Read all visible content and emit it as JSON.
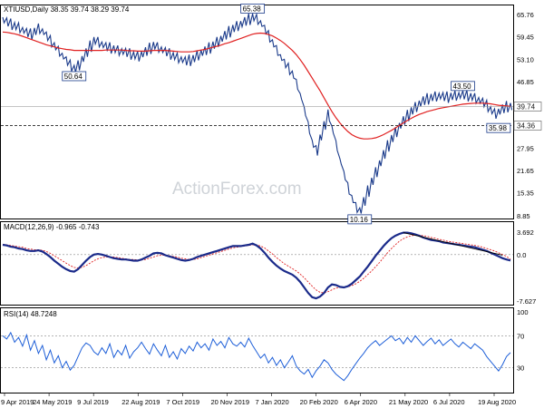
{
  "header": {
    "symbol_line": "XTIUSD,Daily  38.35 39.74 38.29 39.74",
    "macd_line": "MACD(12,26,9) -0.965 -0.743",
    "rsi_line": "RSI(14) 48.7248"
  },
  "watermark": "ActionForex.com",
  "colors": {
    "price": "#1a3a8a",
    "ma": "#e02020",
    "macd": "#1a2a8a",
    "signal": "#e02020",
    "rsi": "#1e5fd8",
    "trend": "#000000",
    "grid": "#b8b8b8"
  },
  "chart_data": [
    {
      "type": "line",
      "panel": "price",
      "x_dates": [
        "9 Apr 2019",
        "24 May 2019",
        "9 Jul 2019",
        "22 Aug 2019",
        "7 Oct 2019",
        "20 Nov 2019",
        "7 Jan 2020",
        "20 Feb 2020",
        "6 Apr 2020",
        "21 May 2020",
        "6 Jul 2020",
        "19 Aug 2020"
      ],
      "y_ticks": [
        "65.76",
        "59.45",
        "53.10",
        "46.85",
        "40.55",
        "34.26",
        "27.95",
        "21.65",
        "15.35",
        "8.85"
      ],
      "ylim": [
        8.85,
        65.76
      ],
      "price_box": "39.74",
      "dashed_level": "34.36",
      "series": [
        {
          "values": [
            64.2,
            63.6,
            63.0,
            62.5,
            62.0,
            61.3,
            60.6,
            60.2,
            61.0,
            61.8,
            60.9,
            59.6,
            58.2,
            56.8,
            55.4,
            54.0,
            52.6,
            51.3,
            50.4,
            51.4,
            53.2,
            55.0,
            56.8,
            58.4,
            58.0,
            57.2,
            56.6,
            56.3,
            56.0,
            55.6,
            55.3,
            55.0,
            54.6,
            54.2,
            53.9,
            54.5,
            55.3,
            56.2,
            57.0,
            56.5,
            55.8,
            55.2,
            54.6,
            54.0,
            53.5,
            53.0,
            52.6,
            52.8,
            53.3,
            54.2,
            54.9,
            55.5,
            56.3,
            57.1,
            58.0,
            58.9,
            59.9,
            60.9,
            61.8,
            62.5,
            63.1,
            63.8,
            64.4,
            65.0,
            64.4,
            63.2,
            61.5,
            59.6,
            57.6,
            55.6,
            53.6,
            51.9,
            50.4,
            48.8,
            46.0,
            42.6,
            38.4,
            33.8,
            29.2,
            27.3,
            31.0,
            34.4,
            37.3,
            33.2,
            28.7,
            24.2,
            20.2,
            16.6,
            13.6,
            11.2,
            10.3,
            12.9,
            15.8,
            18.6,
            21.2,
            23.7,
            26.2,
            28.6,
            30.7,
            32.5,
            34.3,
            35.8,
            37.2,
            38.5,
            39.6,
            40.6,
            41.4,
            41.9,
            42.3,
            42.6,
            42.7,
            42.5,
            42.4,
            42.6,
            42.8,
            42.9,
            43.0,
            42.8,
            42.5,
            42.1,
            41.5,
            40.9,
            39.9,
            38.7,
            37.7,
            38.3,
            39.1,
            39.7,
            39.74
          ]
        },
        {
          "name_hidden": true,
          "values": [
            60.8,
            60.7,
            60.5,
            60.3,
            60.0,
            59.6,
            59.2,
            58.8,
            58.4,
            58.0,
            57.6,
            57.2,
            56.9,
            56.6,
            56.3,
            56.1,
            55.9,
            55.8,
            55.6,
            55.6,
            55.6,
            55.6,
            55.6,
            55.6,
            55.6,
            55.6,
            55.7,
            55.7,
            55.7,
            55.7,
            55.7,
            55.6,
            55.5,
            55.5,
            55.4,
            55.4,
            55.4,
            55.5,
            55.6,
            55.6,
            55.6,
            55.6,
            55.5,
            55.4,
            55.3,
            55.2,
            55.2,
            55.2,
            55.3,
            55.5,
            55.7,
            55.9,
            56.2,
            56.5,
            56.8,
            57.1,
            57.5,
            57.8,
            58.2,
            58.6,
            59.0,
            59.4,
            59.8,
            60.2,
            60.4,
            60.5,
            60.4,
            60.1,
            59.7,
            59.1,
            58.4,
            57.6,
            56.6,
            55.6,
            54.4,
            53.0,
            51.4,
            49.6,
            47.8,
            46.0,
            44.2,
            42.2,
            40.2,
            38.3,
            36.6,
            35.1,
            33.8,
            32.7,
            31.8,
            31.2,
            30.8,
            30.6,
            30.6,
            30.7,
            30.9,
            31.3,
            31.8,
            32.4,
            33.0,
            33.7,
            34.4,
            35.1,
            35.8,
            36.4,
            37.0,
            37.5,
            37.9,
            38.3,
            38.6,
            38.9,
            39.2,
            39.4,
            39.6,
            39.8,
            40.0,
            40.2,
            40.4,
            40.5,
            40.6,
            40.7,
            40.7,
            40.7,
            40.6,
            40.5,
            40.3,
            40.1,
            40.0,
            39.9,
            39.8
          ]
        }
      ],
      "annotations": [
        {
          "text": "65.38",
          "value": 65.38,
          "index": 63
        },
        {
          "text": "50.64",
          "value": 50.64,
          "index": 18
        },
        {
          "text": "10.16",
          "value": 10.16,
          "index": 90
        },
        {
          "text": "43.50",
          "value": 43.5,
          "index": 116
        },
        {
          "text": "35.98",
          "value": 35.98,
          "index": 125
        }
      ]
    },
    {
      "type": "line",
      "panel": "macd",
      "y_ticks": [
        "3.692",
        "0.0",
        "-7.627"
      ],
      "ylim": [
        -7.627,
        3.692
      ],
      "series": [
        {
          "values": [
            1.6,
            1.5,
            1.3,
            1.2,
            1.0,
            0.9,
            0.7,
            0.6,
            0.6,
            0.7,
            0.5,
            0.1,
            -0.4,
            -1.0,
            -1.5,
            -2.0,
            -2.4,
            -2.7,
            -2.8,
            -2.4,
            -1.7,
            -1.0,
            -0.4,
            0.0,
            0.1,
            0.0,
            -0.2,
            -0.4,
            -0.6,
            -0.7,
            -0.8,
            -0.8,
            -0.9,
            -1.0,
            -1.0,
            -0.8,
            -0.5,
            -0.2,
            0.2,
            0.3,
            0.2,
            -0.1,
            -0.3,
            -0.5,
            -0.7,
            -0.9,
            -1.0,
            -0.9,
            -0.7,
            -0.4,
            -0.2,
            0.0,
            0.2,
            0.4,
            0.6,
            0.8,
            1.0,
            1.2,
            1.4,
            1.4,
            1.4,
            1.5,
            1.6,
            1.8,
            1.5,
            1.0,
            0.3,
            -0.5,
            -1.2,
            -1.8,
            -2.3,
            -2.7,
            -3.0,
            -3.3,
            -3.8,
            -4.5,
            -5.4,
            -6.3,
            -7.0,
            -7.2,
            -6.9,
            -6.3,
            -5.4,
            -4.9,
            -5.0,
            -5.3,
            -5.4,
            -5.2,
            -4.8,
            -4.2,
            -3.6,
            -2.8,
            -2.0,
            -1.1,
            -0.2,
            0.6,
            1.4,
            2.1,
            2.7,
            3.1,
            3.4,
            3.6,
            3.6,
            3.5,
            3.3,
            3.1,
            2.8,
            2.6,
            2.4,
            2.3,
            2.2,
            2.0,
            1.9,
            1.8,
            1.7,
            1.6,
            1.5,
            1.4,
            1.3,
            1.2,
            1.0,
            0.8,
            0.6,
            0.3,
            0.0,
            -0.3,
            -0.6,
            -0.8,
            -0.97
          ]
        },
        {
          "values": [
            1.7,
            1.6,
            1.5,
            1.4,
            1.3,
            1.2,
            1.0,
            0.9,
            0.8,
            0.8,
            0.7,
            0.5,
            0.2,
            -0.2,
            -0.6,
            -1.0,
            -1.4,
            -1.8,
            -2.1,
            -2.2,
            -2.1,
            -1.8,
            -1.4,
            -1.0,
            -0.7,
            -0.5,
            -0.4,
            -0.4,
            -0.4,
            -0.5,
            -0.6,
            -0.7,
            -0.8,
            -0.8,
            -0.9,
            -0.9,
            -0.8,
            -0.6,
            -0.4,
            -0.2,
            -0.1,
            -0.1,
            -0.2,
            -0.3,
            -0.4,
            -0.6,
            -0.7,
            -0.8,
            -0.8,
            -0.7,
            -0.5,
            -0.3,
            -0.1,
            0.1,
            0.3,
            0.5,
            0.7,
            0.9,
            1.1,
            1.2,
            1.3,
            1.4,
            1.5,
            1.6,
            1.6,
            1.4,
            1.1,
            0.6,
            0.1,
            -0.5,
            -1.0,
            -1.5,
            -1.9,
            -2.3,
            -2.7,
            -3.2,
            -3.8,
            -4.5,
            -5.2,
            -5.8,
            -6.2,
            -6.3,
            -6.1,
            -5.8,
            -5.5,
            -5.4,
            -5.4,
            -5.3,
            -5.1,
            -4.8,
            -4.4,
            -3.9,
            -3.3,
            -2.7,
            -2.0,
            -1.3,
            -0.5,
            0.3,
            1.0,
            1.6,
            2.2,
            2.6,
            2.9,
            3.1,
            3.2,
            3.2,
            3.1,
            3.0,
            2.8,
            2.7,
            2.5,
            2.4,
            2.2,
            2.1,
            2.0,
            1.9,
            1.8,
            1.7,
            1.6,
            1.5,
            1.4,
            1.2,
            1.0,
            0.8,
            0.6,
            0.3,
            0.0,
            -0.3,
            -0.74
          ]
        }
      ]
    },
    {
      "type": "line",
      "panel": "rsi",
      "y_ticks": [
        "100",
        "70",
        "30",
        "0"
      ],
      "ylim": [
        0,
        100
      ],
      "series": [
        {
          "values": [
            70,
            66,
            74,
            62,
            68,
            57,
            71,
            52,
            64,
            48,
            58,
            40,
            52,
            36,
            45,
            30,
            38,
            27,
            33,
            44,
            55,
            61,
            58,
            50,
            46,
            55,
            48,
            60,
            43,
            52,
            46,
            58,
            42,
            50,
            55,
            62,
            54,
            47,
            60,
            52,
            45,
            58,
            43,
            50,
            41,
            54,
            48,
            57,
            51,
            62,
            55,
            60,
            52,
            66,
            58,
            63,
            55,
            68,
            60,
            57,
            62,
            56,
            67,
            58,
            50,
            42,
            47,
            36,
            43,
            33,
            40,
            30,
            37,
            45,
            32,
            26,
            22,
            28,
            18,
            26,
            32,
            40,
            36,
            28,
            22,
            18,
            14,
            20,
            28,
            35,
            42,
            48,
            55,
            60,
            64,
            58,
            62,
            66,
            70,
            64,
            67,
            60,
            68,
            62,
            70,
            64,
            58,
            63,
            67,
            60,
            65,
            58,
            62,
            66,
            60,
            56,
            62,
            58,
            54,
            60,
            56,
            52,
            44,
            38,
            32,
            26,
            34,
            44,
            49
          ]
        }
      ]
    }
  ]
}
